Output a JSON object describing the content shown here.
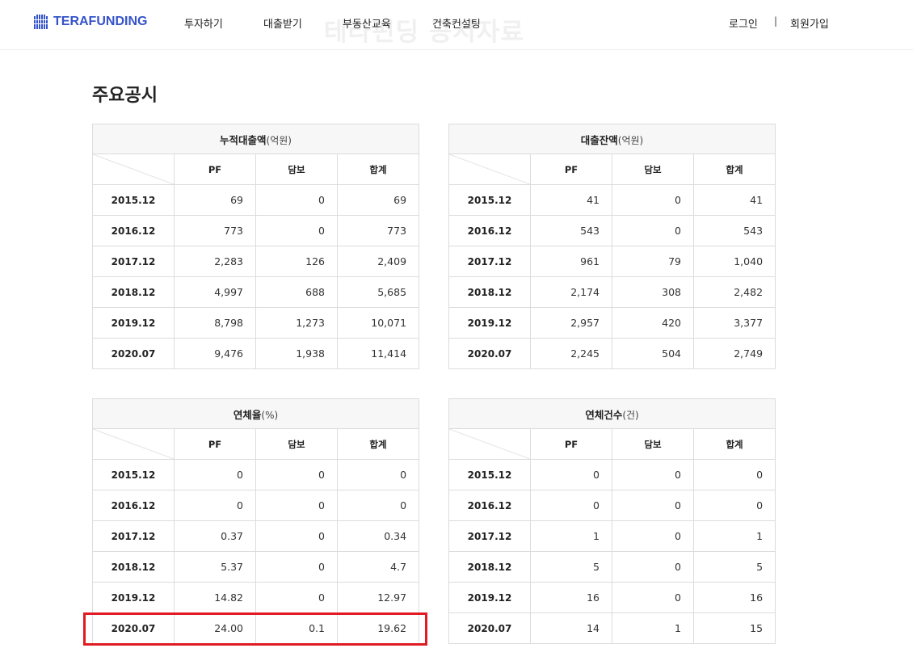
{
  "header": {
    "logo_text": "TERAFUNDING",
    "watermark": "테라펀딩 공시자료",
    "nav": [
      "투자하기",
      "대출받기",
      "부동산교육",
      "건축컨설팅"
    ],
    "login": "로그인",
    "separator": "|",
    "signup": "회원가입",
    "brand_color": "#3553c9"
  },
  "page_title": "주요공시",
  "tables": [
    {
      "title": "누적대출액",
      "unit": "(억원)",
      "columns": [
        "PF",
        "담보",
        "합계"
      ],
      "rows": [
        {
          "year": "2015.12",
          "pf": "69",
          "collateral": "0",
          "total": "69"
        },
        {
          "year": "2016.12",
          "pf": "773",
          "collateral": "0",
          "total": "773"
        },
        {
          "year": "2017.12",
          "pf": "2,283",
          "collateral": "126",
          "total": "2,409"
        },
        {
          "year": "2018.12",
          "pf": "4,997",
          "collateral": "688",
          "total": "5,685"
        },
        {
          "year": "2019.12",
          "pf": "8,798",
          "collateral": "1,273",
          "total": "10,071"
        },
        {
          "year": "2020.07",
          "pf": "9,476",
          "collateral": "1,938",
          "total": "11,414"
        }
      ]
    },
    {
      "title": "대출잔액",
      "unit": "(억원)",
      "columns": [
        "PF",
        "담보",
        "합계"
      ],
      "rows": [
        {
          "year": "2015.12",
          "pf": "41",
          "collateral": "0",
          "total": "41"
        },
        {
          "year": "2016.12",
          "pf": "543",
          "collateral": "0",
          "total": "543"
        },
        {
          "year": "2017.12",
          "pf": "961",
          "collateral": "79",
          "total": "1,040"
        },
        {
          "year": "2018.12",
          "pf": "2,174",
          "collateral": "308",
          "total": "2,482"
        },
        {
          "year": "2019.12",
          "pf": "2,957",
          "collateral": "420",
          "total": "3,377"
        },
        {
          "year": "2020.07",
          "pf": "2,245",
          "collateral": "504",
          "total": "2,749"
        }
      ]
    },
    {
      "title": "연체율",
      "unit": "(%)",
      "columns": [
        "PF",
        "담보",
        "합계"
      ],
      "rows": [
        {
          "year": "2015.12",
          "pf": "0",
          "collateral": "0",
          "total": "0"
        },
        {
          "year": "2016.12",
          "pf": "0",
          "collateral": "0",
          "total": "0"
        },
        {
          "year": "2017.12",
          "pf": "0.37",
          "collateral": "0",
          "total": "0.34"
        },
        {
          "year": "2018.12",
          "pf": "5.37",
          "collateral": "0",
          "total": "4.7"
        },
        {
          "year": "2019.12",
          "pf": "14.82",
          "collateral": "0",
          "total": "12.97"
        },
        {
          "year": "2020.07",
          "pf": "24.00",
          "collateral": "0.1",
          "total": "19.62"
        }
      ]
    },
    {
      "title": "연체건수",
      "unit": "(건)",
      "columns": [
        "PF",
        "담보",
        "합계"
      ],
      "rows": [
        {
          "year": "2015.12",
          "pf": "0",
          "collateral": "0",
          "total": "0"
        },
        {
          "year": "2016.12",
          "pf": "0",
          "collateral": "0",
          "total": "0"
        },
        {
          "year": "2017.12",
          "pf": "1",
          "collateral": "0",
          "total": "1"
        },
        {
          "year": "2018.12",
          "pf": "5",
          "collateral": "0",
          "total": "5"
        },
        {
          "year": "2019.12",
          "pf": "16",
          "collateral": "0",
          "total": "16"
        },
        {
          "year": "2020.07",
          "pf": "14",
          "collateral": "1",
          "total": "15"
        }
      ]
    }
  ],
  "highlight_color": "#e01b24"
}
